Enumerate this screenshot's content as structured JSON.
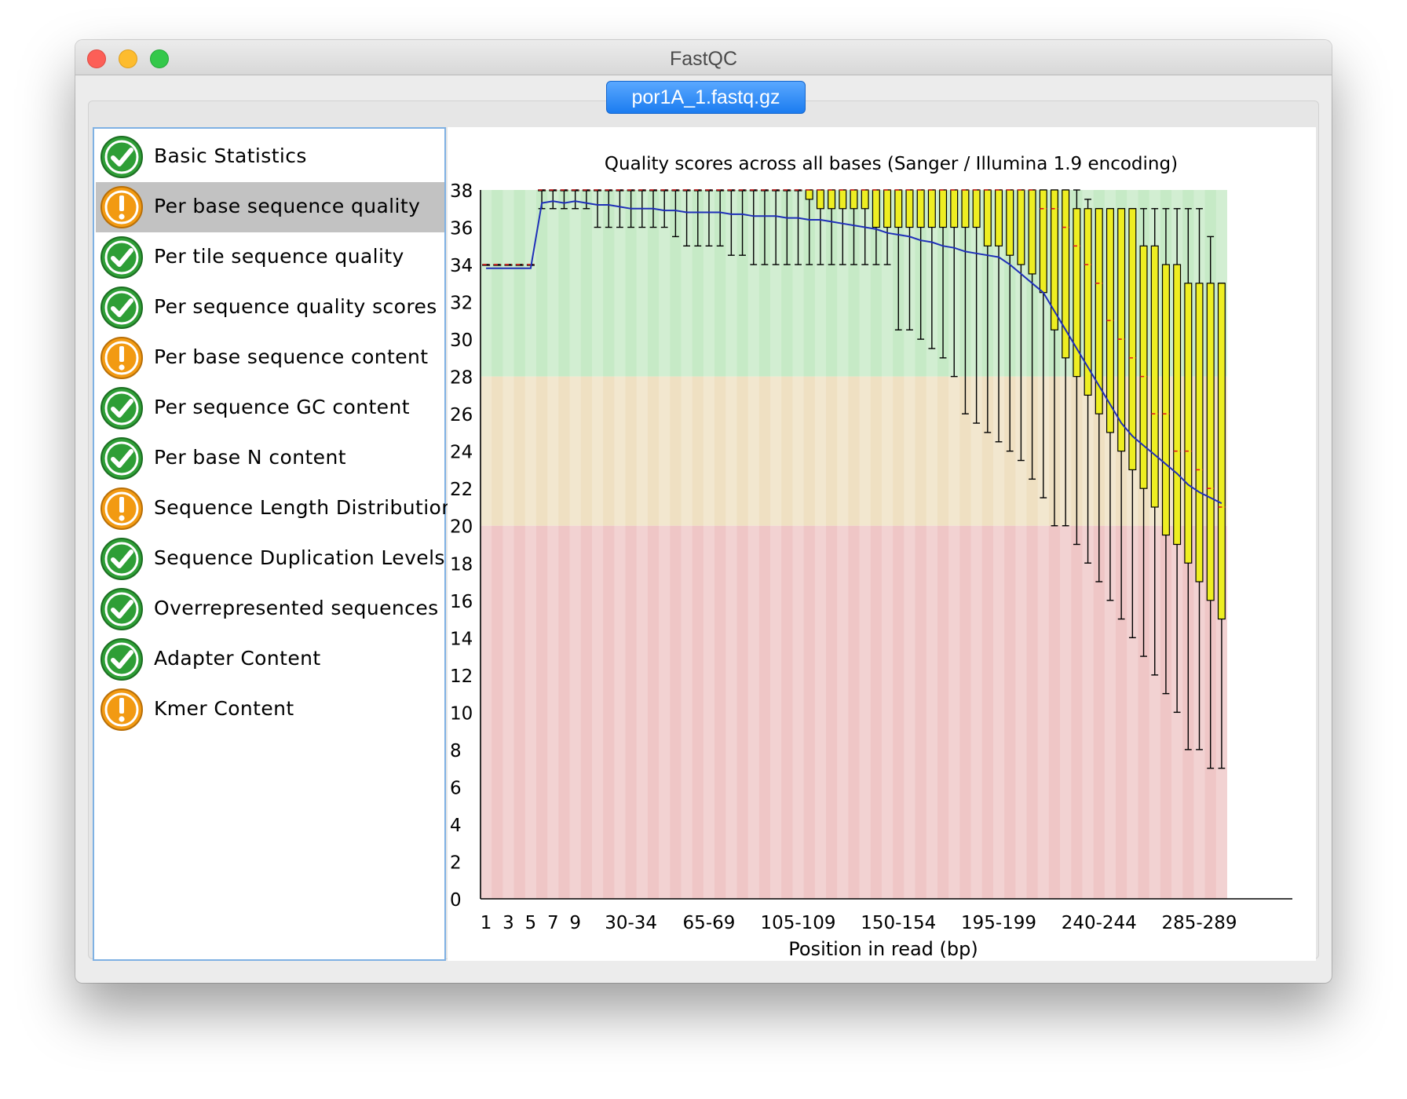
{
  "window": {
    "title": "FastQC"
  },
  "file_tab": {
    "label": "por1A_1.fastq.gz"
  },
  "modules": [
    {
      "label": "Basic Statistics",
      "status": "pass",
      "icon": "pass-check-icon"
    },
    {
      "label": "Per base sequence quality",
      "status": "warn",
      "icon": "warning-icon",
      "selected": true
    },
    {
      "label": "Per tile sequence quality",
      "status": "pass",
      "icon": "pass-check-icon"
    },
    {
      "label": "Per sequence quality scores",
      "status": "pass",
      "icon": "pass-check-icon"
    },
    {
      "label": "Per base sequence content",
      "status": "warn",
      "icon": "warning-icon"
    },
    {
      "label": "Per sequence GC content",
      "status": "pass",
      "icon": "pass-check-icon"
    },
    {
      "label": "Per base N content",
      "status": "pass",
      "icon": "pass-check-icon"
    },
    {
      "label": "Sequence Length Distribution",
      "status": "warn",
      "icon": "warning-icon"
    },
    {
      "label": "Sequence Duplication Levels",
      "status": "pass",
      "icon": "pass-check-icon"
    },
    {
      "label": "Overrepresented sequences",
      "status": "pass",
      "icon": "pass-check-icon"
    },
    {
      "label": "Adapter Content",
      "status": "pass",
      "icon": "pass-check-icon"
    },
    {
      "label": "Kmer Content",
      "status": "warn",
      "icon": "warning-icon"
    }
  ],
  "colors": {
    "pass": "#2e9e36",
    "warn": "#f29a12",
    "band_good": "#c6eac6",
    "band_ok": "#efe0c2",
    "band_bad": "#efc6c6",
    "box_fill": "#eeee22",
    "mean_line": "#1f2fb8",
    "median_mark": "#e02020"
  },
  "chart_data": {
    "type": "box",
    "title": "Quality scores across all bases (Sanger / Illumina 1.9 encoding)",
    "xlabel": "Position in read (bp)",
    "ylabel": "",
    "ylim": [
      0,
      38
    ],
    "yticks": [
      0,
      2,
      4,
      6,
      8,
      10,
      12,
      14,
      16,
      18,
      20,
      22,
      24,
      26,
      28,
      30,
      32,
      34,
      36,
      38
    ],
    "xtick_labels": [
      "1",
      "3",
      "5",
      "7",
      "9",
      "30-34",
      "65-69",
      "105-109",
      "150-154",
      "195-199",
      "240-244",
      "285-289"
    ],
    "bands": [
      {
        "name": "good",
        "from": 28,
        "to": 38
      },
      {
        "name": "reasonable",
        "from": 20,
        "to": 28
      },
      {
        "name": "poor",
        "from": 0,
        "to": 20
      }
    ],
    "categories": [
      "1",
      "2",
      "3",
      "4",
      "5",
      "6",
      "7",
      "8",
      "9",
      "10-14",
      "15-19",
      "20-24",
      "25-29",
      "30-34",
      "35-39",
      "40-44",
      "45-49",
      "50-54",
      "55-59",
      "60-64",
      "65-69",
      "70-74",
      "75-79",
      "80-84",
      "85-89",
      "90-94",
      "95-99",
      "100-104",
      "105-109",
      "110-114",
      "115-119",
      "120-124",
      "125-129",
      "130-134",
      "135-139",
      "140-144",
      "145-149",
      "150-154",
      "155-159",
      "160-164",
      "165-169",
      "170-174",
      "175-179",
      "180-184",
      "185-189",
      "190-194",
      "195-199",
      "200-204",
      "205-209",
      "210-214",
      "215-219",
      "220-224",
      "225-229",
      "230-234",
      "235-239",
      "240-244",
      "245-249",
      "250-254",
      "255-259",
      "260-264",
      "265-269",
      "270-274",
      "275-279",
      "280-284",
      "285-289",
      "290-294",
      "295-299"
    ],
    "mean": [
      33.8,
      33.8,
      33.8,
      33.8,
      33.8,
      37.3,
      37.4,
      37.3,
      37.4,
      37.3,
      37.2,
      37.2,
      37.1,
      37.0,
      37.0,
      37.0,
      36.9,
      36.9,
      36.8,
      36.8,
      36.8,
      36.8,
      36.7,
      36.7,
      36.6,
      36.6,
      36.6,
      36.5,
      36.5,
      36.4,
      36.4,
      36.3,
      36.2,
      36.1,
      36.0,
      35.9,
      35.7,
      35.6,
      35.5,
      35.3,
      35.2,
      35.0,
      34.9,
      34.7,
      34.6,
      34.5,
      34.4,
      34.0,
      33.5,
      33.0,
      32.5,
      31.5,
      30.5,
      29.5,
      28.5,
      27.5,
      26.5,
      25.5,
      24.8,
      24.3,
      23.8,
      23.3,
      22.8,
      22.2,
      21.8,
      21.5,
      21.2
    ],
    "median": [
      34,
      34,
      34,
      34,
      34,
      38,
      38,
      38,
      38,
      38,
      38,
      38,
      38,
      38,
      38,
      38,
      38,
      38,
      38,
      38,
      38,
      38,
      38,
      38,
      38,
      38,
      38,
      38,
      38,
      38,
      38,
      38,
      38,
      38,
      38,
      38,
      38,
      38,
      38,
      38,
      38,
      38,
      38,
      38,
      38,
      38,
      38,
      38,
      38,
      38,
      37,
      37,
      36,
      35,
      34,
      33,
      31,
      30,
      29,
      28,
      26,
      26,
      24,
      24,
      23,
      22,
      21
    ],
    "q1": [
      34,
      34,
      34,
      34,
      34,
      38,
      38,
      38,
      38,
      38,
      38,
      38,
      38,
      38,
      38,
      38,
      38,
      38,
      38,
      38,
      38,
      38,
      38,
      38,
      38,
      38,
      38,
      38,
      38,
      37.5,
      37,
      37,
      37,
      37,
      37,
      36,
      36,
      36,
      36,
      36,
      36,
      36,
      36,
      36,
      36,
      35,
      35,
      34.5,
      34,
      33.5,
      32.5,
      30.5,
      29,
      28,
      27,
      26,
      25,
      24,
      23,
      22,
      21,
      19.5,
      19,
      18,
      17,
      16,
      15
    ],
    "q3": [
      34,
      34,
      34,
      34,
      34,
      38,
      38,
      38,
      38,
      38,
      38,
      38,
      38,
      38,
      38,
      38,
      38,
      38,
      38,
      38,
      38,
      38,
      38,
      38,
      38,
      38,
      38,
      38,
      38,
      38,
      38,
      38,
      38,
      38,
      38,
      38,
      38,
      38,
      38,
      38,
      38,
      38,
      38,
      38,
      38,
      38,
      38,
      38,
      38,
      38,
      38,
      38,
      38,
      37,
      37,
      37,
      37,
      37,
      37,
      35,
      35,
      34,
      34,
      33,
      33,
      33,
      33
    ],
    "p10": [
      34,
      34,
      34,
      34,
      34,
      37,
      37,
      37,
      37,
      37,
      36,
      36,
      36,
      36,
      36,
      36,
      36,
      35.5,
      35,
      35,
      35,
      35,
      34.5,
      34.5,
      34,
      34,
      34,
      34,
      34,
      34,
      34,
      34,
      34,
      34,
      34,
      34,
      34,
      30.5,
      30.5,
      30,
      29.5,
      29,
      28,
      26,
      25.5,
      25,
      24.5,
      24,
      23.5,
      22.5,
      21.5,
      20,
      20,
      19,
      18,
      17,
      16,
      15,
      14,
      13,
      12,
      11,
      10,
      8,
      8,
      7,
      7
    ],
    "p90": [
      34,
      34,
      34,
      34,
      34,
      38,
      38,
      38,
      38,
      38,
      38,
      38,
      38,
      38,
      38,
      38,
      38,
      38,
      38,
      38,
      38,
      38,
      38,
      38,
      38,
      38,
      38,
      38,
      38,
      38,
      38,
      38,
      38,
      38,
      38,
      38,
      38,
      38,
      38,
      38,
      38,
      38,
      38,
      38,
      38,
      38,
      38,
      38,
      38,
      38,
      38,
      38,
      38,
      38,
      37.5,
      37,
      37,
      37,
      37,
      37,
      37,
      37,
      37,
      37,
      37,
      35.5,
      33
    ]
  }
}
